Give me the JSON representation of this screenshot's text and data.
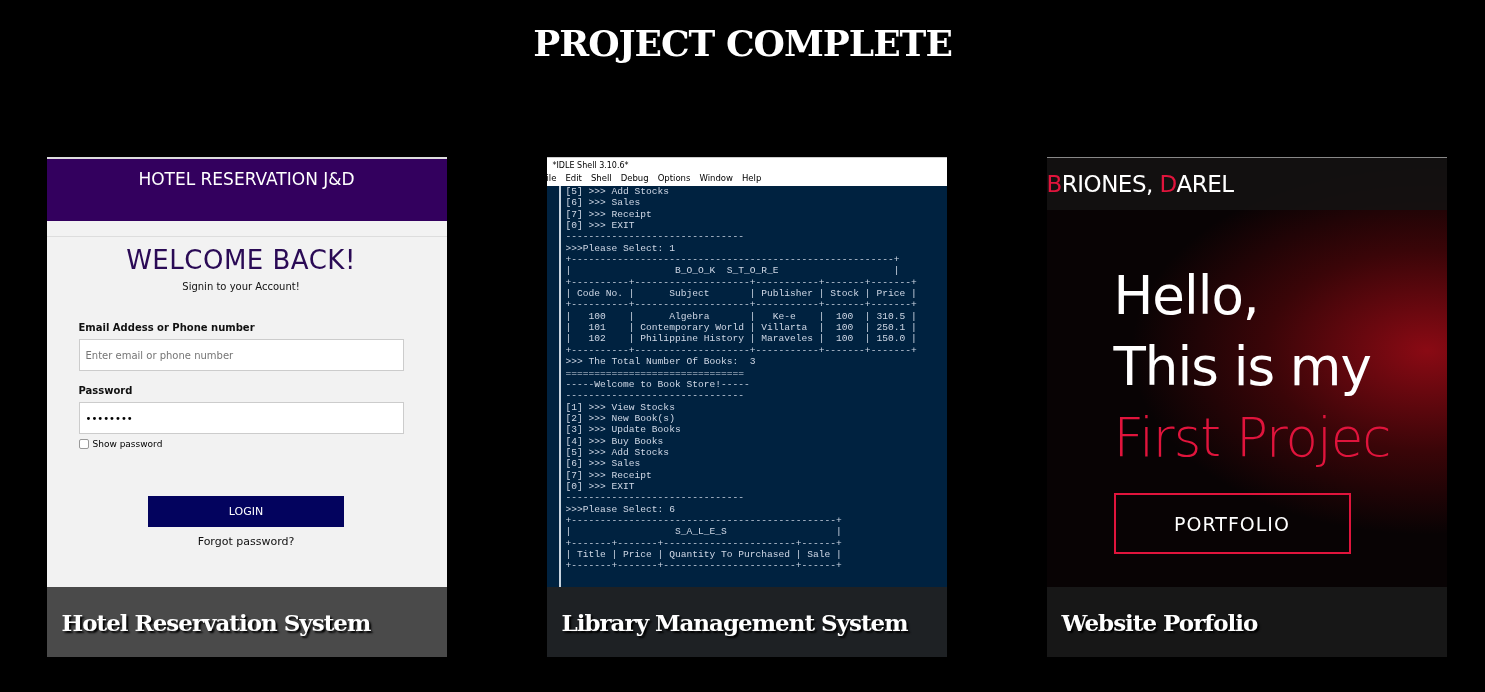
{
  "title": "PROJECT COMPLETE",
  "projects": [
    {
      "kind": "hotel",
      "caption": "Hotel Reservation System",
      "screen": {
        "header": "HOTEL RESERVATION J&D",
        "heading": "WELCOME BACK!",
        "subheading": "Signin to your Account!",
        "email_label": "Email Addess or Phone number",
        "email_placeholder": "Enter email or phone number",
        "password_label": "Password",
        "password_value": "••••••••",
        "show_password": {
          "label": "Show password",
          "checked": false
        },
        "login_button": "LOGIN",
        "forgot_link": "Forgot password?"
      }
    },
    {
      "kind": "terminal",
      "caption": "Library Management System",
      "screen": {
        "window_title": "*IDLE Shell 3.10.6*",
        "menu": [
          "ile",
          "Edit",
          "Shell",
          "Debug",
          "Options",
          "Window",
          "Help"
        ],
        "lines": [
          "[5] >>> Add Stocks",
          "[6] >>> Sales",
          "[7] >>> Receipt",
          "[0] >>> EXIT",
          "-------------------------------",
          ">>>Please Select: 1",
          "+--------------------------------------------------------+",
          "|                  B_O_O_K  S_T_O_R_E                    |",
          "+----------+--------------------+-----------+-------+-------+",
          "| Code No. |      Subject       | Publisher | Stock | Price |",
          "+----------+--------------------+-----------+-------+-------+",
          "|   100    |      Algebra       |   Ke-e    |  100  | 310.5 |",
          "|   101    | Contemporary World | Villarta  |  100  | 250.1 |",
          "|   102    | Philippine History | Maraveles |  100  | 150.0 |",
          "+----------+--------------------+-----------+-------+-------+",
          ">>> The Total Number Of Books:  3",
          "===============================",
          "-----Welcome to Book Store!-----",
          "-------------------------------",
          "[1] >>> View Stocks",
          "[2] >>> New Book(s)",
          "[3] >>> Update Books",
          "[4] >>> Buy Books",
          "[5] >>> Add Stocks",
          "[6] >>> Sales",
          "[7] >>> Receipt",
          "[0] >>> EXIT",
          "-------------------------------",
          ">>>Please Select: 6",
          "+----------------------------------------------+",
          "|                  S_A_L_E_S                   |",
          "+-------+-------+-----------------------+------+",
          "| Title | Price | Quantity To Purchased | Sale |",
          "+-------+-------+-----------------------+------+"
        ]
      }
    },
    {
      "kind": "portfolio",
      "caption": "Website Porfolio",
      "screen": {
        "brand": [
          {
            "text": "B",
            "accent": true
          },
          {
            "text": "RIONES, ",
            "accent": false
          },
          {
            "text": "D",
            "accent": true
          },
          {
            "text": "AREL",
            "accent": false
          }
        ],
        "hero_lines": [
          {
            "text": "Hello,",
            "accent": false
          },
          {
            "text": "This is my",
            "accent": false
          },
          {
            "text": "First Projec",
            "accent": true
          }
        ],
        "button": "PORTFOLIO"
      }
    }
  ]
}
